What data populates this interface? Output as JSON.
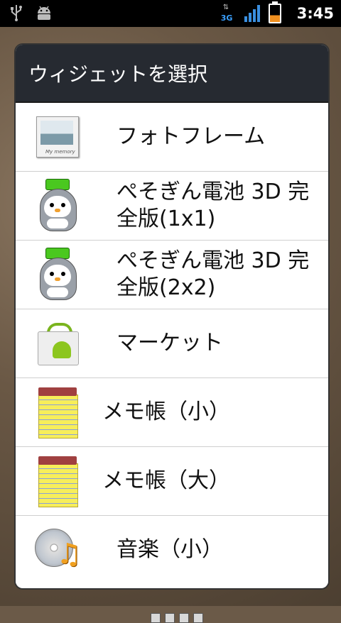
{
  "status_bar": {
    "time": "3:45",
    "network_type": "3G",
    "network_arrows": "⇅",
    "icons": [
      "usb-icon",
      "android-debug-icon",
      "network-3g-icon",
      "signal-icon",
      "battery-charging-icon"
    ]
  },
  "dialog": {
    "title": "ウィジェットを選択",
    "items": [
      {
        "label": "フォトフレーム",
        "icon": "photo-frame-icon"
      },
      {
        "label_line1": "ぺそぎん電池 3D 完",
        "label_line2": "全版(1x1)",
        "icon": "penguin-battery-icon"
      },
      {
        "label_line1": "ぺそぎん電池 3D 完",
        "label_line2": "全版(2x2)",
        "icon": "penguin-battery-icon"
      },
      {
        "label": "マーケット",
        "icon": "market-icon"
      },
      {
        "label": "メモ帳（小）",
        "icon": "notepad-icon"
      },
      {
        "label": "メモ帳（大）",
        "icon": "notepad-icon"
      },
      {
        "label": "音楽（小）",
        "icon": "music-icon"
      }
    ]
  },
  "colors": {
    "title_bar": "#262a31",
    "list_bg": "#ffffff",
    "divider": "#cfcfcf",
    "status_bar": "#000000"
  }
}
